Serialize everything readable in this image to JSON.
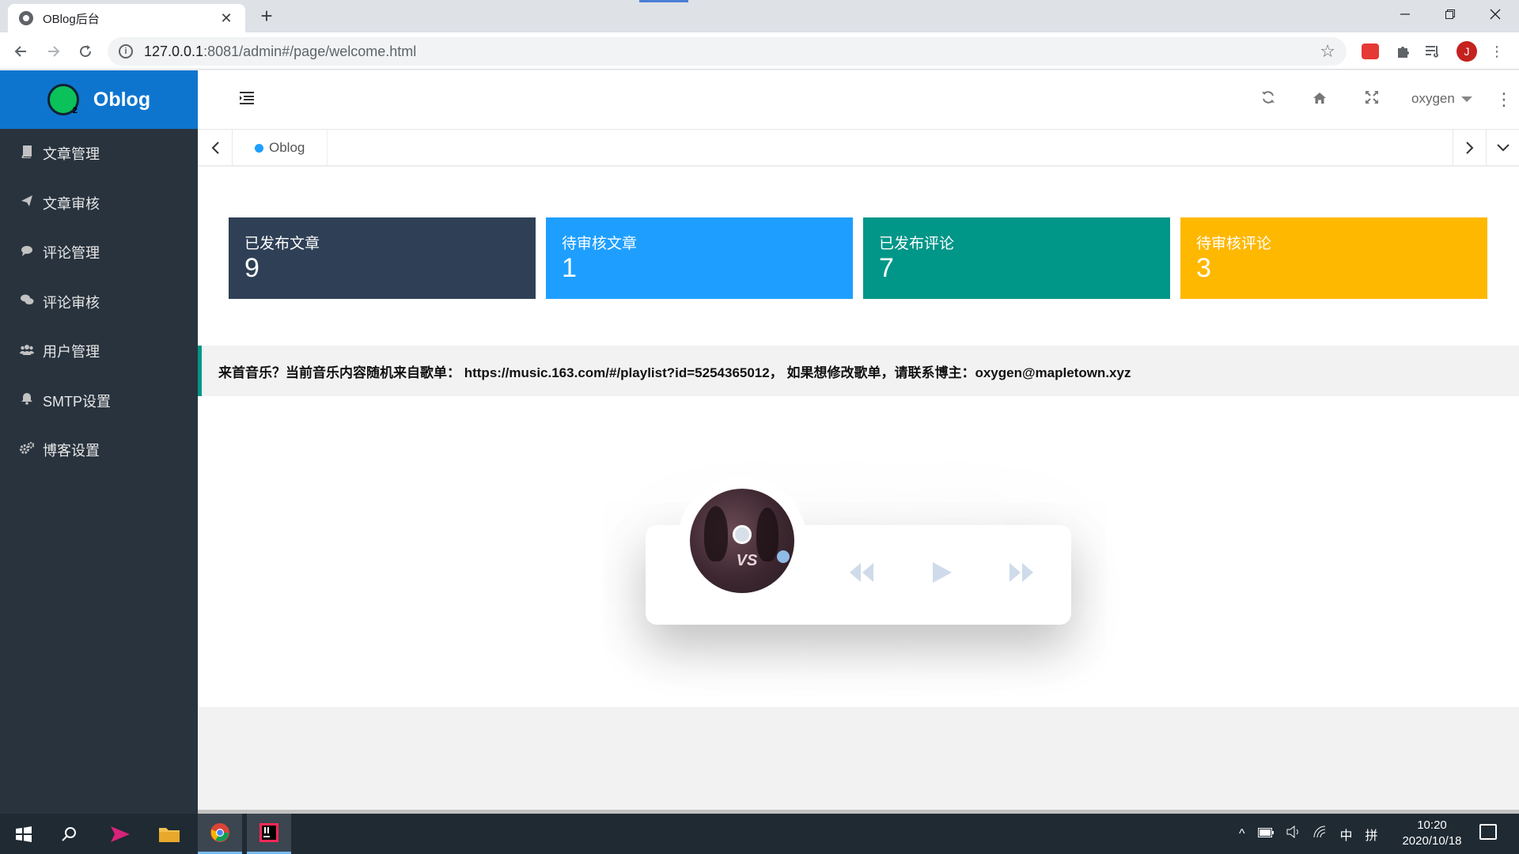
{
  "browser": {
    "tab_title": "OBlog后台",
    "tab_close": "✕",
    "new_tab": "+",
    "url_host": "127.0.0.1",
    "url_rest": ":8081/admin#/page/welcome.html",
    "avatar_letter": "J"
  },
  "sidebar": {
    "logo_name": "Oblog",
    "items": [
      {
        "label": "文章管理",
        "icon": "book-icon"
      },
      {
        "label": "文章审核",
        "icon": "paper-plane-icon"
      },
      {
        "label": "评论管理",
        "icon": "comment-icon"
      },
      {
        "label": "评论审核",
        "icon": "comments-icon"
      },
      {
        "label": "用户管理",
        "icon": "users-icon"
      },
      {
        "label": "SMTP设置",
        "icon": "bell-icon"
      },
      {
        "label": "博客设置",
        "icon": "gears-icon"
      }
    ]
  },
  "header": {
    "username": "oxygen"
  },
  "tabstrip": {
    "active_tab": "Oblog"
  },
  "cards": [
    {
      "label": "已发布文章",
      "value": "9",
      "color": "#2f4056"
    },
    {
      "label": "待审核文章",
      "value": "1",
      "color": "#1e9fff"
    },
    {
      "label": "已发布评论",
      "value": "7",
      "color": "#009688"
    },
    {
      "label": "待审核评论",
      "value": "3",
      "color": "#ffb800"
    }
  ],
  "notice": {
    "text": "来首音乐？当前音乐内容随机来自歌单： https://music.163.com/#/playlist?id=5254365012， 如果想修改歌单，请联系博主：oxygen@mapletown.xyz"
  },
  "player": {
    "cover_text": "VS"
  },
  "taskbar": {
    "time": "10:20",
    "date": "2020/10/18",
    "ime": "中",
    "ime2": "拼"
  }
}
